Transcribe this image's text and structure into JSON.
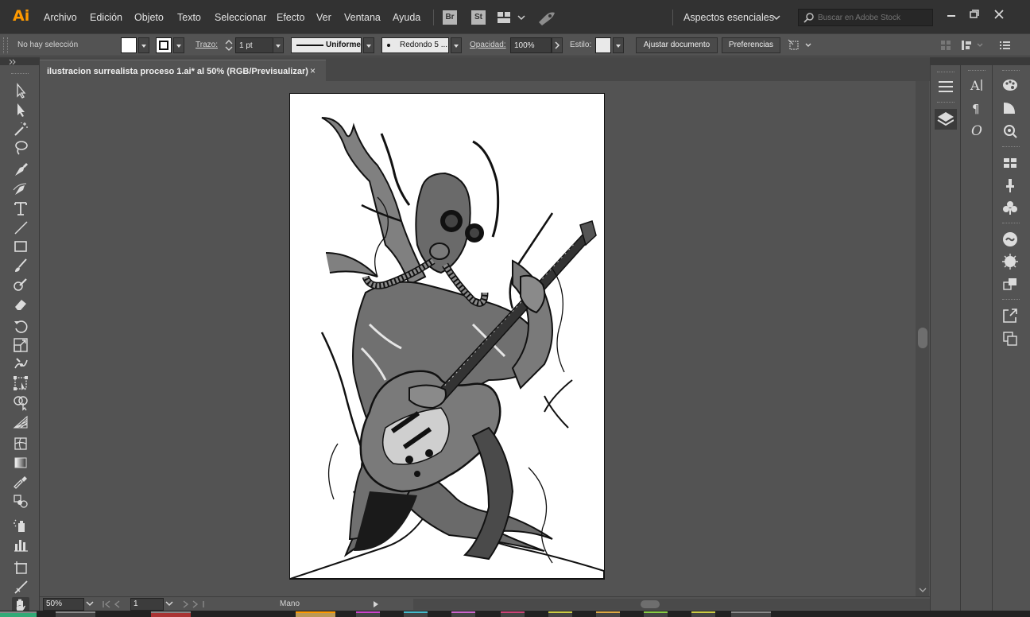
{
  "app": {
    "logo": "Ai"
  },
  "menu": [
    "Archivo",
    "Edición",
    "Objeto",
    "Texto",
    "Seleccionar",
    "Efecto",
    "Ver",
    "Ventana",
    "Ayuda"
  ],
  "bridge": {
    "br": "Br",
    "st": "St"
  },
  "workspace": {
    "label": "Aspectos esenciales"
  },
  "stock_search": {
    "placeholder": "Buscar en Adobe Stock"
  },
  "control": {
    "selection": "No hay selección",
    "stroke_label": "Trazo:",
    "stroke_value": "1 pt",
    "profile": "Uniforme",
    "brush": "Redondo 5 ...",
    "opacity_label": "Opacidad:",
    "opacity_value": "100%",
    "style_label": "Estilo:",
    "adjust_doc": "Ajustar documento",
    "preferences": "Preferencias"
  },
  "document": {
    "tab_title": "ilustracion surrealista proceso 1.ai* al 50% (RGB/Previsualizar)",
    "close": "×"
  },
  "status": {
    "zoom": "50%",
    "artboard": "1",
    "tool": "Mano"
  },
  "colors": {
    "accent": "#ff9a00",
    "menubar": "#323232",
    "workspace": "#535353",
    "artboard": "#ffffff"
  },
  "tools": [
    "selection-tool",
    "direct-selection-tool",
    "magic-wand-tool",
    "lasso-tool",
    "pen-tool",
    "curvature-tool",
    "type-tool",
    "line-tool",
    "rectangle-tool",
    "paintbrush-tool",
    "shaper-tool",
    "eraser-tool",
    "rotate-tool",
    "scale-tool",
    "puppet-warp-tool",
    "free-transform-tool",
    "shape-builder-tool",
    "perspective-grid-tool",
    "mesh-tool",
    "gradient-tool",
    "eyedropper-tool",
    "blend-tool",
    "symbol-sprayer-tool",
    "column-graph-tool",
    "artboard-tool",
    "slice-tool",
    "hand-tool"
  ]
}
